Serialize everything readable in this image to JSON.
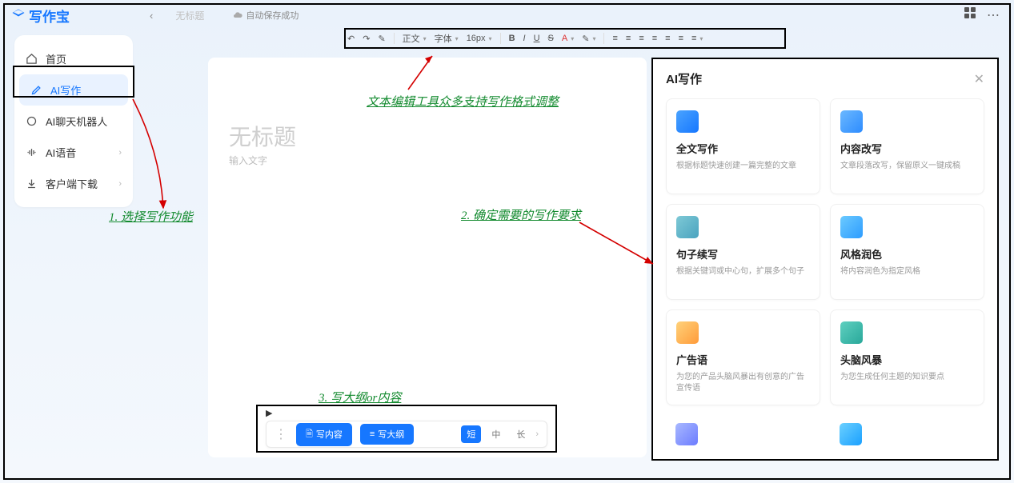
{
  "app": {
    "name": "写作宝"
  },
  "header": {
    "untitled": "无标题",
    "autosave": "自动保存成功"
  },
  "sidebar": {
    "items": [
      {
        "label": "首页"
      },
      {
        "label": "AI写作"
      },
      {
        "label": "AI聊天机器人"
      },
      {
        "label": "AI语音"
      },
      {
        "label": "客户端下载"
      }
    ]
  },
  "toolbar": {
    "style": "正文",
    "font": "字体",
    "size": "16px",
    "bold": "B",
    "italic": "I",
    "underline": "U",
    "strike": "S",
    "color": "A"
  },
  "editor": {
    "title_placeholder": "无标题",
    "body_placeholder": "输入文字"
  },
  "actions": {
    "write_content": "写内容",
    "write_outline": "写大纲",
    "len_short": "短",
    "len_mid": "中",
    "len_long": "长"
  },
  "ai_panel": {
    "title": "AI写作",
    "cards": [
      {
        "title": "全文写作",
        "desc": "根据标题快速创建一篇完整的文章"
      },
      {
        "title": "内容改写",
        "desc": "文章段落改写，保留原义一键成稿"
      },
      {
        "title": "句子续写",
        "desc": "根据关键词或中心句，扩展多个句子"
      },
      {
        "title": "风格润色",
        "desc": "将内容润色为指定风格"
      },
      {
        "title": "广告语",
        "desc": "为您的产品头脑风暴出有创意的广告宣传语"
      },
      {
        "title": "头脑风暴",
        "desc": "为您生成任何主题的知识要点"
      }
    ]
  },
  "annotations": {
    "a1": "1. 选择写作功能",
    "a2": "2. 确定需要的写作要求",
    "a3": "3. 写大纲or内容",
    "a_toolbar": "文本编辑工具众多支持写作格式调整"
  }
}
